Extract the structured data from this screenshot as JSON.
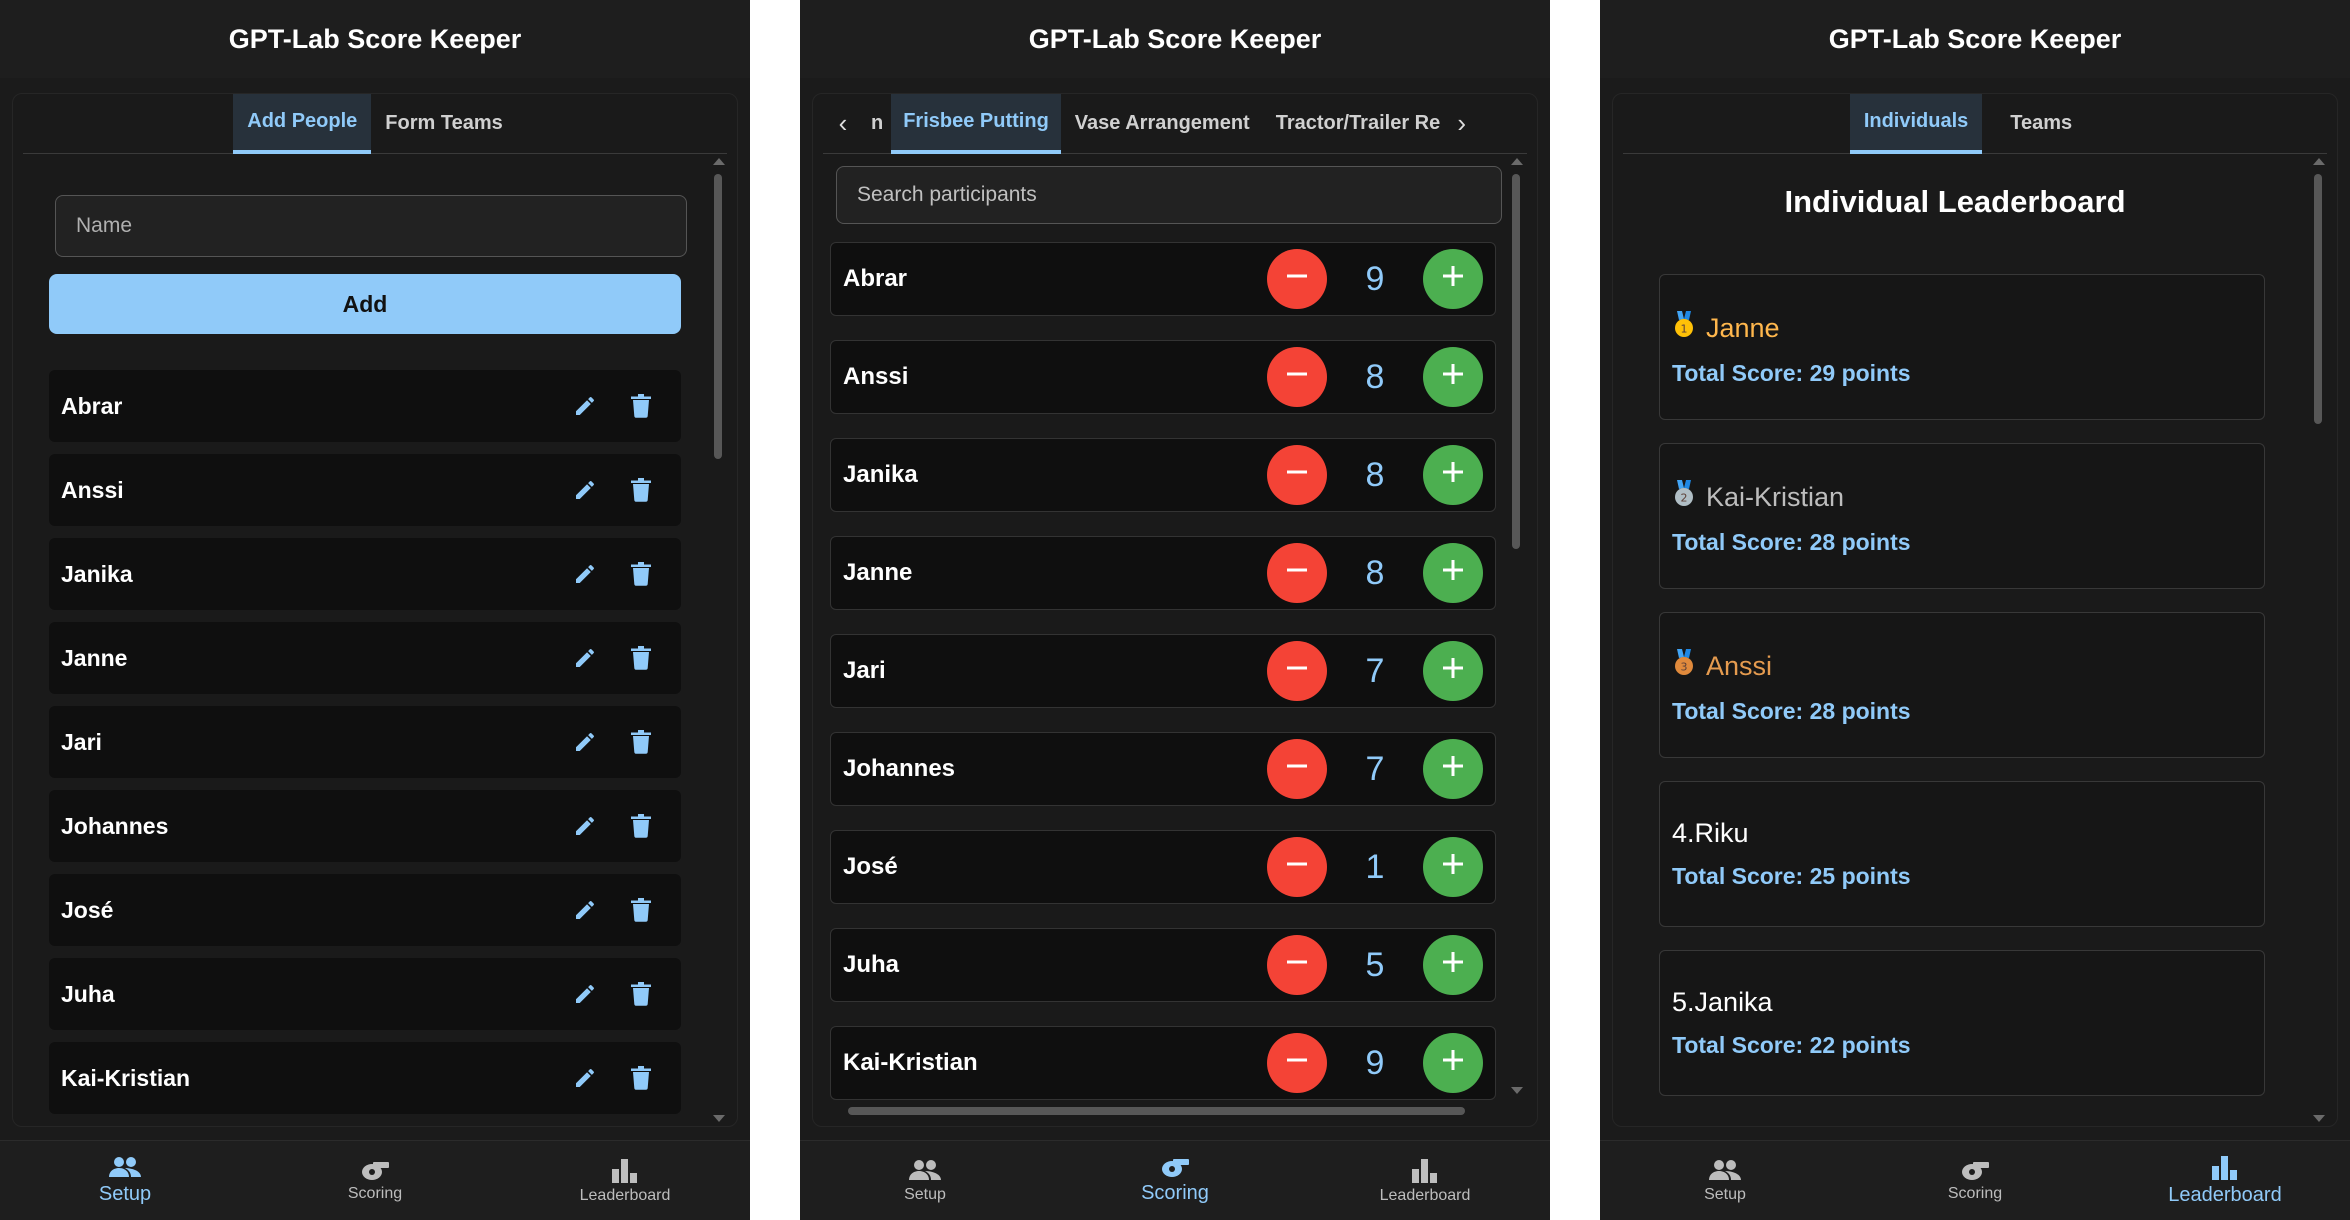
{
  "app_title": "GPT-Lab Score Keeper",
  "colors": {
    "accent": "#90caf9",
    "minus": "#f44336",
    "plus": "#4caf50",
    "gold": "#ffb74d",
    "silver": "#bdbdbd",
    "bronze": "#e59b4f"
  },
  "nav": {
    "setup": "Setup",
    "scoring": "Scoring",
    "leaderboard": "Leaderboard"
  },
  "setup": {
    "tabs": [
      "Add People",
      "Form Teams"
    ],
    "name_placeholder": "Name",
    "add_label": "Add",
    "people": [
      "Abrar",
      "Anssi",
      "Janika",
      "Janne",
      "Jari",
      "Johannes",
      "José",
      "Juha",
      "Kai-Kristian"
    ]
  },
  "scoring": {
    "tabs": [
      "n",
      "Frisbee Putting",
      "Vase Arrangement",
      "Tractor/Trailer Re"
    ],
    "search_placeholder": "Search participants",
    "rows": [
      {
        "name": "Abrar",
        "score": "9"
      },
      {
        "name": "Anssi",
        "score": "8"
      },
      {
        "name": "Janika",
        "score": "8"
      },
      {
        "name": "Janne",
        "score": "8"
      },
      {
        "name": "Jari",
        "score": "7"
      },
      {
        "name": "Johannes",
        "score": "7"
      },
      {
        "name": "José",
        "score": "1"
      },
      {
        "name": "Juha",
        "score": "5"
      },
      {
        "name": "Kai-Kristian",
        "score": "9"
      }
    ]
  },
  "leaderboard": {
    "tabs": [
      "Individuals",
      "Teams"
    ],
    "title": "Individual Leaderboard",
    "entries": [
      {
        "rank_label": "",
        "medal": "gold-medal-icon",
        "name": "Janne",
        "score_text": "Total Score: 29 points"
      },
      {
        "rank_label": "",
        "medal": "silver-medal-icon",
        "name": "Kai-Kristian",
        "score_text": "Total Score: 28 points"
      },
      {
        "rank_label": "",
        "medal": "bronze-medal-icon",
        "name": "Anssi",
        "score_text": "Total Score: 28 points"
      },
      {
        "rank_label": "4. ",
        "medal": "",
        "name": "Riku",
        "score_text": "Total Score: 25 points"
      },
      {
        "rank_label": "5. ",
        "medal": "",
        "name": "Janika",
        "score_text": "Total Score: 22 points"
      }
    ]
  }
}
